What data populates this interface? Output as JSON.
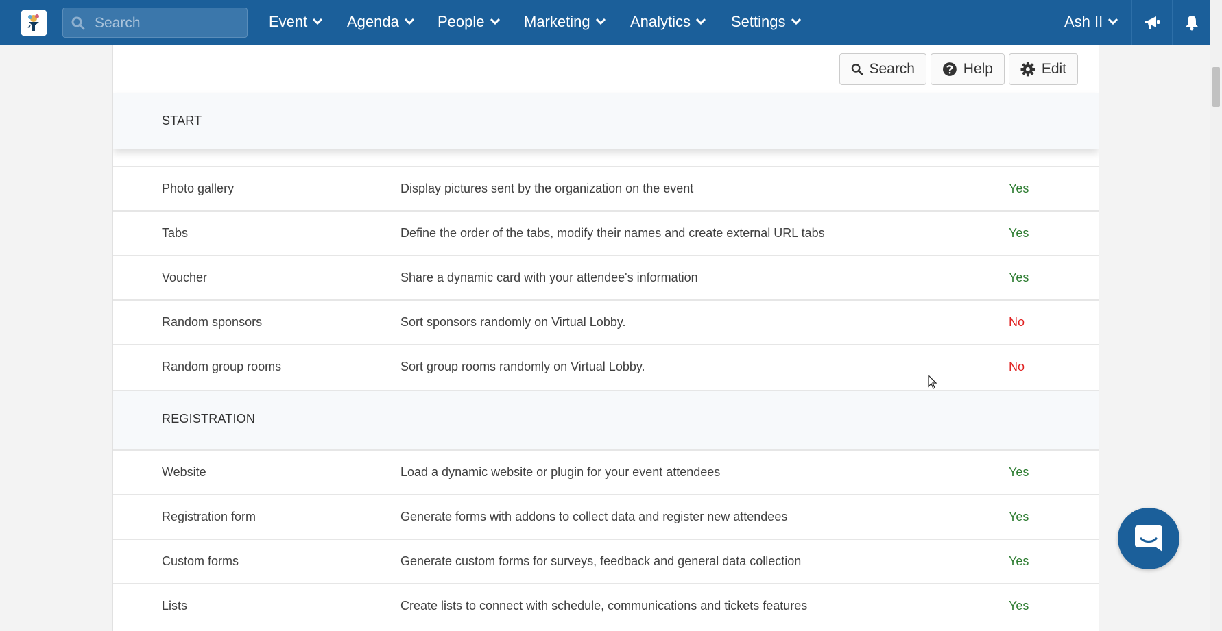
{
  "navbar": {
    "search_placeholder": "Search",
    "menus": [
      {
        "label": "Event"
      },
      {
        "label": "Agenda"
      },
      {
        "label": "People"
      },
      {
        "label": "Marketing"
      },
      {
        "label": "Analytics"
      },
      {
        "label": "Settings"
      }
    ],
    "user": "Ash II",
    "icons": [
      "megaphone-icon",
      "bell-icon"
    ],
    "color": "#1b5f9a"
  },
  "toolbar": {
    "search_label": "Search",
    "help_label": "Help",
    "edit_label": "Edit"
  },
  "sections": [
    {
      "title": "START",
      "rows": [
        {
          "name": "Photo gallery",
          "description": "Display pictures sent by the organization on the event",
          "value": "Yes"
        },
        {
          "name": "Tabs",
          "description": "Define the order of the tabs, modify their names and create external URL tabs",
          "value": "Yes"
        },
        {
          "name": "Voucher",
          "description": "Share a dynamic card with your attendee's information",
          "value": "Yes"
        },
        {
          "name": "Random sponsors",
          "description": "Sort sponsors randomly on Virtual Lobby.",
          "value": "No"
        },
        {
          "name": "Random group rooms",
          "description": "Sort group rooms randomly on Virtual Lobby.",
          "value": "No"
        }
      ]
    },
    {
      "title": "REGISTRATION",
      "rows": [
        {
          "name": "Website",
          "description": "Load a dynamic website or plugin for your event attendees",
          "value": "Yes"
        },
        {
          "name": "Registration form",
          "description": "Generate forms with addons to collect data and register new attendees",
          "value": "Yes"
        },
        {
          "name": "Custom forms",
          "description": "Generate custom forms for surveys, feedback and general data collection",
          "value": "Yes"
        },
        {
          "name": "Lists",
          "description": "Create lists to connect with schedule, communications and tickets features",
          "value": "Yes"
        }
      ]
    }
  ],
  "status_colors": {
    "yes": "#2e7d32",
    "no": "#e02020"
  },
  "chat_widget": {
    "icon": "chat-icon"
  }
}
